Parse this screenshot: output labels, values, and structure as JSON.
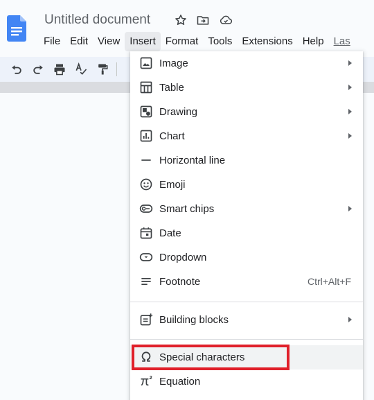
{
  "document": {
    "title": "Untitled document"
  },
  "title_icons": [
    "star-icon",
    "move-to-folder-icon",
    "cloud-saved-icon"
  ],
  "menubar": {
    "items": [
      {
        "label": "File"
      },
      {
        "label": "Edit"
      },
      {
        "label": "View"
      },
      {
        "label": "Insert",
        "active": true
      },
      {
        "label": "Format"
      },
      {
        "label": "Tools"
      },
      {
        "label": "Extensions"
      },
      {
        "label": "Help"
      },
      {
        "label": "Las"
      }
    ]
  },
  "toolbar": {
    "buttons": [
      "undo-icon",
      "redo-icon",
      "print-icon",
      "spellcheck-icon",
      "paint-format-icon"
    ]
  },
  "insert_menu": {
    "items": [
      {
        "label": "Image",
        "icon": "image-icon",
        "submenu": true
      },
      {
        "label": "Table",
        "icon": "table-icon",
        "submenu": true
      },
      {
        "label": "Drawing",
        "icon": "drawing-icon",
        "submenu": true
      },
      {
        "label": "Chart",
        "icon": "chart-icon",
        "submenu": true
      },
      {
        "label": "Horizontal line",
        "icon": "horizontal-line-icon",
        "submenu": false
      },
      {
        "label": "Emoji",
        "icon": "emoji-icon",
        "submenu": false
      },
      {
        "label": "Smart chips",
        "icon": "smart-chips-icon",
        "submenu": true
      },
      {
        "label": "Date",
        "icon": "calendar-icon",
        "submenu": false
      },
      {
        "label": "Dropdown",
        "icon": "dropdown-icon",
        "submenu": false
      },
      {
        "label": "Footnote",
        "icon": "footnote-icon",
        "submenu": false,
        "shortcut": "Ctrl+Alt+F"
      },
      {
        "label": "Building blocks",
        "icon": "building-blocks-icon",
        "submenu": true
      },
      {
        "label": "Special characters",
        "icon": "omega-icon",
        "submenu": false,
        "highlighted": true
      },
      {
        "label": "Equation",
        "icon": "pi-icon",
        "submenu": false
      }
    ]
  },
  "colors": {
    "brand_blue": "#4285f4",
    "highlight_red": "#e0202a",
    "menu_hover": "#f1f3f4"
  }
}
